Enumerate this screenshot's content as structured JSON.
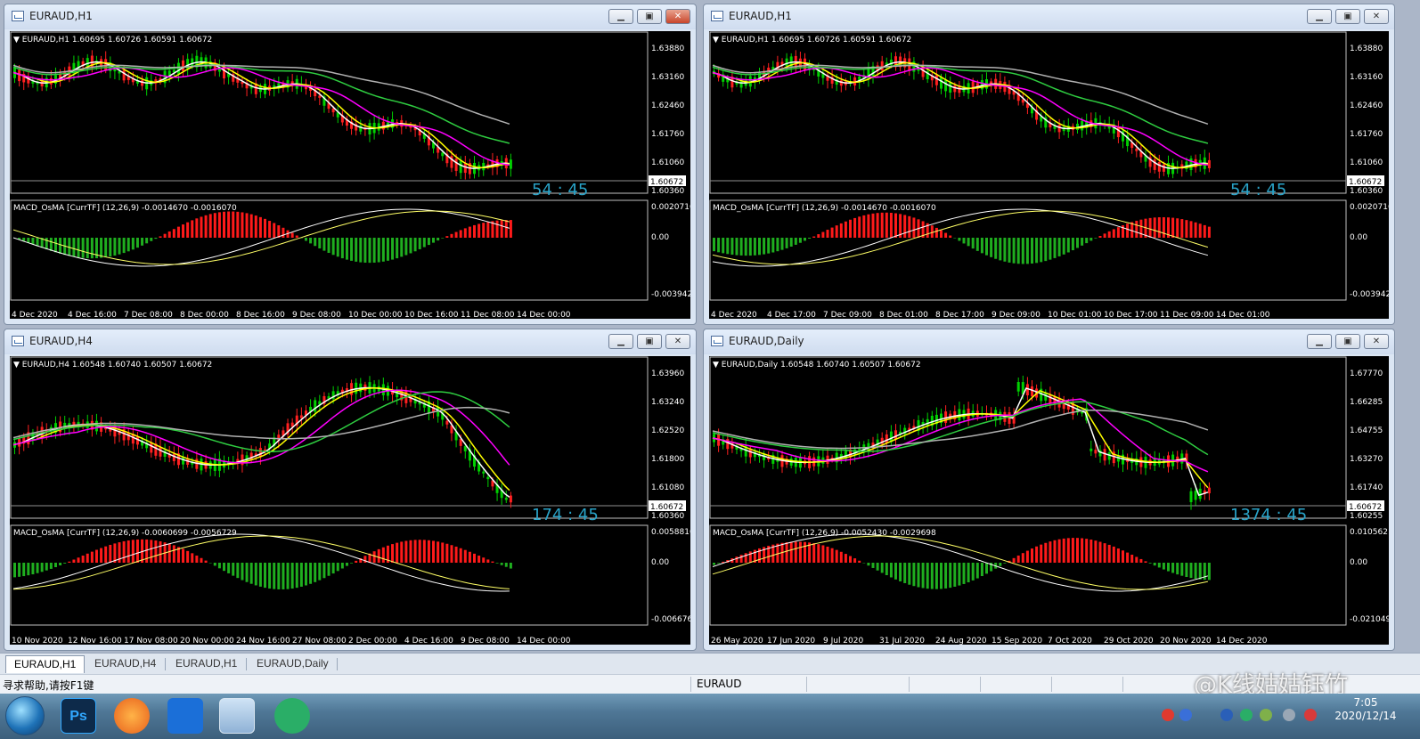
{
  "windows": [
    {
      "title": "EURAUD,H1",
      "header": "EURAUD,H1  1.60695 1.60726 1.60591 1.60672",
      "price_ticks": [
        "1.63880",
        "1.63160",
        "1.62460",
        "1.61760",
        "1.61060",
        "1.60360"
      ],
      "current_price": "1.60672",
      "countdown": "54 : 45",
      "indicator_header": "MACD_OsMA [CurrTF] (12,26,9) -0.0014670 -0.0016070",
      "ind_ticks": [
        "0.0020716",
        "0.00",
        "-0.003942"
      ],
      "time_labels": [
        "4 Dec 2020",
        "4 Dec 16:00",
        "7 Dec 08:00",
        "8 Dec 00:00",
        "8 Dec 16:00",
        "9 Dec 08:00",
        "10 Dec 00:00",
        "10 Dec 16:00",
        "11 Dec 08:00",
        "14 Dec 00:00"
      ],
      "active": true
    },
    {
      "title": "EURAUD,H1",
      "header": "EURAUD,H1  1.60695 1.60726 1.60591 1.60672",
      "price_ticks": [
        "1.63880",
        "1.63160",
        "1.62460",
        "1.61760",
        "1.61060",
        "1.60360"
      ],
      "current_price": "1.60672",
      "countdown": "54 : 45",
      "indicator_header": "MACD_OsMA [CurrTF] (12,26,9) -0.0014670 -0.0016070",
      "ind_ticks": [
        "0.0020716",
        "0.00",
        "-0.003942"
      ],
      "time_labels": [
        "4 Dec 2020",
        "4 Dec 17:00",
        "7 Dec 09:00",
        "8 Dec 01:00",
        "8 Dec 17:00",
        "9 Dec 09:00",
        "10 Dec 01:00",
        "10 Dec 17:00",
        "11 Dec 09:00",
        "14 Dec 01:00"
      ],
      "active": false
    },
    {
      "title": "EURAUD,H4",
      "header": "EURAUD,H4  1.60548 1.60740 1.60507 1.60672",
      "price_ticks": [
        "1.63960",
        "1.63240",
        "1.62520",
        "1.61800",
        "1.61080",
        "1.60360"
      ],
      "current_price": "1.60672",
      "countdown": "174 : 45",
      "indicator_header": "MACD_OsMA [CurrTF] (12,26,9) -0.0060699 -0.0056729",
      "ind_ticks": [
        "0.0058816",
        "0.00",
        "-0.006676"
      ],
      "time_labels": [
        "10 Nov 2020",
        "12 Nov 16:00",
        "17 Nov 08:00",
        "20 Nov 00:00",
        "24 Nov 16:00",
        "27 Nov 08:00",
        "2 Dec 00:00",
        "4 Dec 16:00",
        "9 Dec 08:00",
        "14 Dec 00:00"
      ],
      "active": false
    },
    {
      "title": "EURAUD,Daily",
      "header": "EURAUD,Daily  1.60548 1.60740 1.60507 1.60672",
      "price_ticks": [
        "1.67770",
        "1.66285",
        "1.64755",
        "1.63270",
        "1.61740",
        "1.60255"
      ],
      "current_price": "1.60672",
      "countdown": "1374 : 45",
      "indicator_header": "MACD_OsMA [CurrTF] (12,26,9) -0.0052430 -0.0029698",
      "ind_ticks": [
        "0.0105621",
        "0.00",
        "-0.0210494"
      ],
      "time_labels": [
        "26 May 2020",
        "17 Jun 2020",
        "9 Jul 2020",
        "31 Jul 2020",
        "24 Aug 2020",
        "15 Sep 2020",
        "7 Oct 2020",
        "29 Oct 2020",
        "20 Nov 2020",
        "14 Dec 2020"
      ],
      "active": false
    }
  ],
  "window_buttons": {
    "minimize": "▁",
    "restore": "▣",
    "close": "✕"
  },
  "tabs": [
    "EURAUD,H1",
    "EURAUD,H4",
    "EURAUD,H1",
    "EURAUD,Daily"
  ],
  "status": {
    "help": "寻求帮助,请按F1键",
    "symbol": "EURAUD"
  },
  "taskbar": {
    "apps": [
      "Ps"
    ],
    "time": "7:05",
    "date": "2020/12/14"
  },
  "watermark": "@K线姑姑钰竹",
  "colors": {
    "bull": "#00d000",
    "bear": "#ff2020",
    "ma_fast": "#ffffff",
    "ma_yellow": "#ffff00",
    "ma_magenta": "#ff00ff",
    "ma_green": "#2ecc40",
    "ma_gray": "#b0b0b0",
    "hist_pos": "#ff1a1a",
    "hist_neg": "#1fae1f"
  }
}
